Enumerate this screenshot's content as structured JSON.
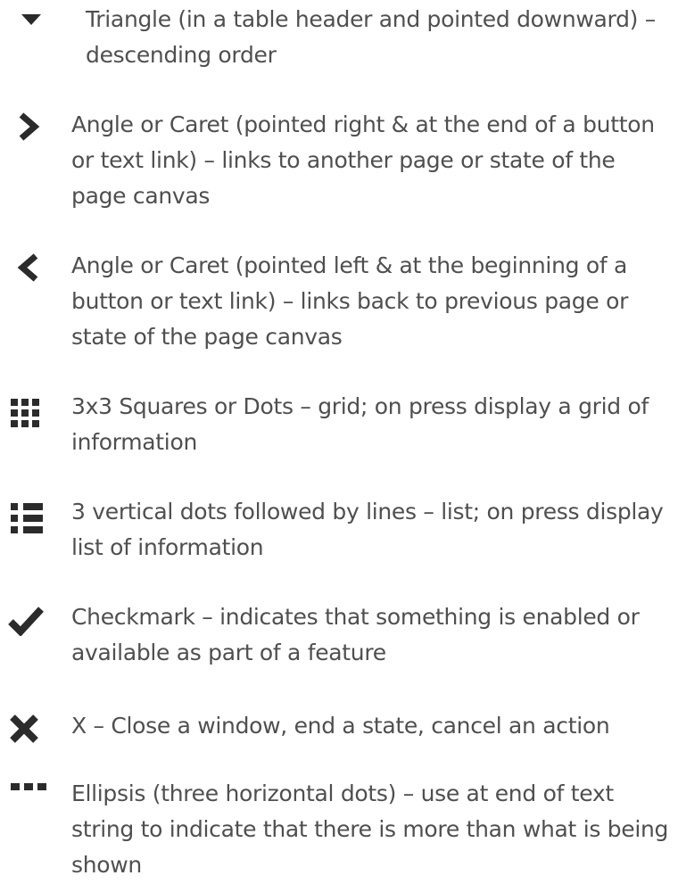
{
  "items": [
    {
      "icon": "triangle-down-icon",
      "text": "Triangle (in a table header and pointed downward) – descending order"
    },
    {
      "icon": "caret-right-icon",
      "text": "Angle or Caret (pointed right & at the end of a button or text link) – links to another page or state of the page canvas"
    },
    {
      "icon": "caret-left-icon",
      "text": "Angle or Caret (pointed left & at the beginning of a button or text link) – links back to previous page or state of the page canvas"
    },
    {
      "icon": "grid-icon",
      "text": "3x3 Squares or Dots – grid; on press display a grid of information"
    },
    {
      "icon": "list-icon",
      "text": "3 vertical dots followed by lines – list; on press display list of information"
    },
    {
      "icon": "checkmark-icon",
      "text": "Checkmark – indicates that something is enabled or available as part of a feature"
    },
    {
      "icon": "close-icon",
      "text": "X – Close a window, end a state, cancel an action"
    },
    {
      "icon": "ellipsis-icon",
      "text": "Ellipsis (three horizontal dots) – use at end of text string to indicate that there is more than what is being shown"
    }
  ],
  "colors": {
    "icon": "#2b2b2b",
    "text": "#4f4f4f"
  }
}
